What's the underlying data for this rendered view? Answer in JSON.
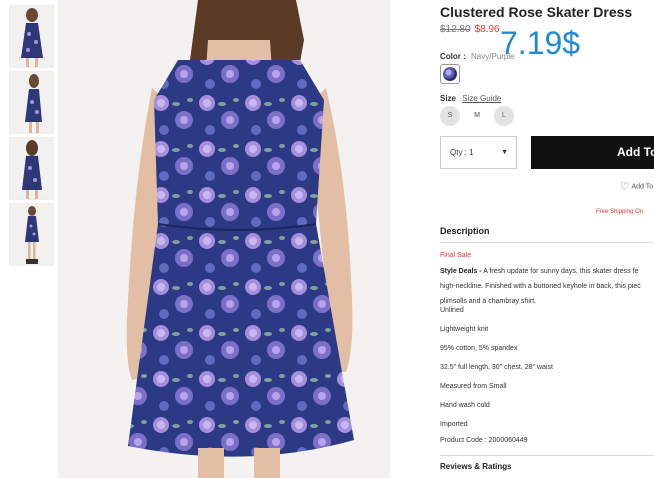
{
  "product": {
    "title": "Clustered Rose Skater Dress",
    "price_original": "$12.80",
    "price_sale": "$8.96",
    "price_overlay": "7.19$"
  },
  "color": {
    "label": "Color",
    "separator": ":",
    "value": "Navy/Purple",
    "swatch_colors": [
      "#27306e",
      "#5a5fb0",
      "#b9a6e8"
    ]
  },
  "size": {
    "label": "Size",
    "guide_link": "Size Guide",
    "options": [
      "S",
      "M",
      "L"
    ]
  },
  "quantity": {
    "label": "Qty : 1",
    "caret_icon": "caret-down"
  },
  "actions": {
    "add_to_bag": "Add To",
    "wishlist": "Add To",
    "wishlist_icon": "heart-outline"
  },
  "shipping_note": "Free Shipping On",
  "description": {
    "heading": "Description",
    "final_sale": "Final Sale",
    "style_deals_label": "Style Deals -",
    "style_deals_line1": "A fresh update for sunny days, this skater dress fe",
    "style_deals_line2": "high-neckline. Finished with a buttoned keyhole in back, this piec",
    "style_deals_line3": "plimsolls and a chambray shirt.",
    "specs": [
      "Unlined",
      "Lightweight knit",
      "95% cotton, 5% spandex",
      "32.5\" full length, 30\" chest, 28\" waist",
      "Measured from Small",
      "Hand wash cold",
      "Imported",
      "Product Code : 2000060449"
    ]
  },
  "reviews_heading": "Reviews & Ratings",
  "accent_colors": {
    "sale_red": "#e53935",
    "overlay_blue": "#1f88d8",
    "button_black": "#111111"
  }
}
